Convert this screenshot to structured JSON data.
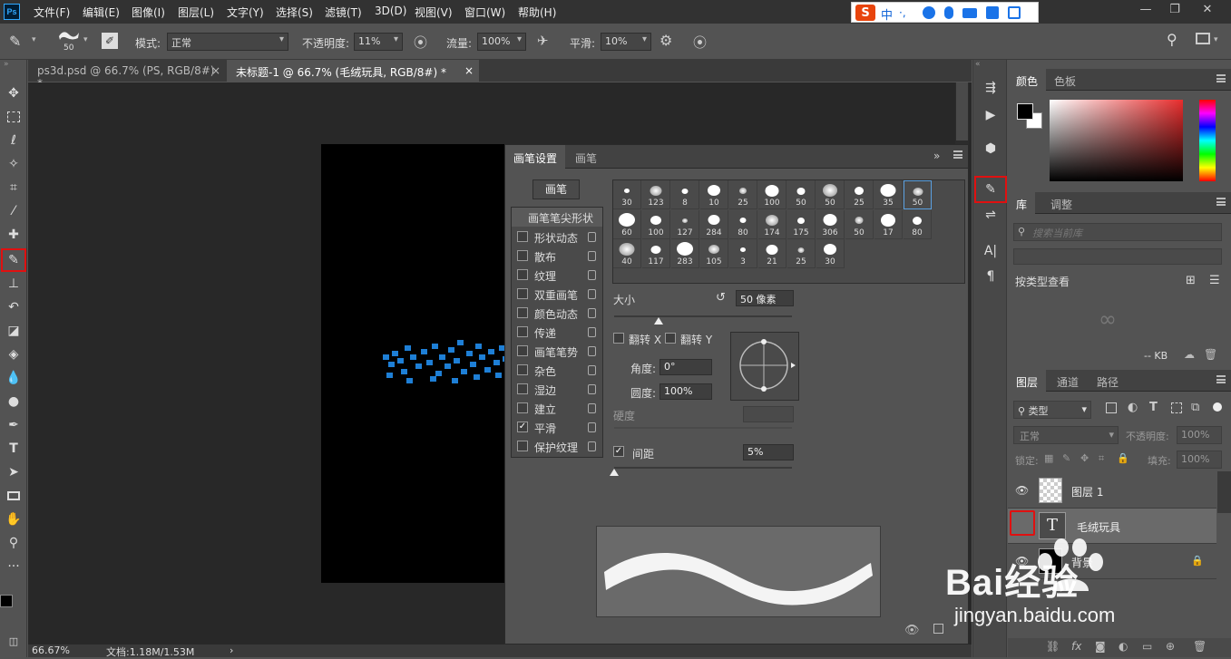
{
  "app": {
    "logo": "Ps"
  },
  "menubar": {
    "items": [
      "文件(F)",
      "编辑(E)",
      "图像(I)",
      "图层(L)",
      "文字(Y)",
      "选择(S)",
      "滤镜(T)",
      "3D(D)",
      "视图(V)",
      "窗口(W)",
      "帮助(H)"
    ],
    "ime": {
      "logo": "S",
      "mode": "中"
    }
  },
  "options": {
    "brush_size": "50",
    "mode_label": "模式:",
    "mode_value": "正常",
    "opacity_label": "不透明度:",
    "opacity_value": "11%",
    "flow_label": "流量:",
    "flow_value": "100%",
    "smooth_label": "平滑:",
    "smooth_value": "10%"
  },
  "tabs": [
    {
      "label": "ps3d.psd @ 66.7% (PS, RGB/8#) *",
      "close": "×"
    },
    {
      "label": "未标题-1 @ 66.7% (毛绒玩具, RGB/8#) *",
      "close": "×"
    }
  ],
  "status": {
    "zoom": "66.67%",
    "doc": "文档:1.18M/1.53M",
    "arrow": "›"
  },
  "brush_panel": {
    "tabs": [
      "画笔设置",
      "画笔"
    ],
    "collapse": "»",
    "brushes_button": "画笔",
    "tip_shape_header": "画笔笔尖形状",
    "options": [
      {
        "label": "形状动态",
        "checked": false
      },
      {
        "label": "散布",
        "checked": false
      },
      {
        "label": "纹理",
        "checked": false
      },
      {
        "label": "双重画笔",
        "checked": false
      },
      {
        "label": "颜色动态",
        "checked": false
      },
      {
        "label": "传递",
        "checked": false
      },
      {
        "label": "画笔笔势",
        "checked": false
      },
      {
        "label": "杂色",
        "checked": false
      },
      {
        "label": "湿边",
        "checked": false
      },
      {
        "label": "建立",
        "checked": false
      },
      {
        "label": "平滑",
        "checked": true
      },
      {
        "label": "保护纹理",
        "checked": false
      }
    ],
    "presets": [
      "30",
      "123",
      "8",
      "10",
      "25",
      "100",
      "50",
      "50",
      "25",
      "35",
      "50",
      "60",
      "100",
      "127",
      "284",
      "80",
      "174",
      "175",
      "306",
      "50",
      "17",
      "80",
      "40",
      "117",
      "283",
      "105",
      "3",
      "21",
      "25",
      "30"
    ],
    "selected_preset_index": 10,
    "size_label": "大小",
    "size_value": "50 像素",
    "size_fraction": 0.25,
    "flip_x": "翻转 X",
    "flip_y": "翻转 Y",
    "angle_label": "角度:",
    "angle_value": "0°",
    "roundness_label": "圆度:",
    "roundness_value": "100%",
    "hardness_label": "硬度",
    "spacing_label": "间距",
    "spacing_value": "5%",
    "spacing_checked": true,
    "spacing_fraction": 0.0
  },
  "color_panel": {
    "tabs": [
      "颜色",
      "色板"
    ]
  },
  "library_panel": {
    "tabs": [
      "库",
      "调整"
    ],
    "search_placeholder": "搜索当前库",
    "view_label": "按类型查看",
    "size_label": "-- KB"
  },
  "layers_panel": {
    "tabs": [
      "图层",
      "通道",
      "路径"
    ],
    "filter_label": "类型",
    "blend_mode": "正常",
    "opacity_label": "不透明度:",
    "opacity_value": "100%",
    "lock_label": "锁定:",
    "fill_label": "填充:",
    "fill_value": "100%",
    "layers": [
      {
        "name": "图层 1",
        "visible": true,
        "type": "pixel"
      },
      {
        "name": "毛绒玩具",
        "visible": false,
        "type": "text"
      },
      {
        "name": "背景",
        "visible": true,
        "type": "background"
      }
    ]
  },
  "watermark": {
    "text": "Bai经验",
    "url": "jingyan.baidu.com"
  },
  "colors": {
    "accent": "#31a8ff",
    "highlight": "#e01010",
    "foreground": "#000000",
    "background": "#ffffff"
  }
}
